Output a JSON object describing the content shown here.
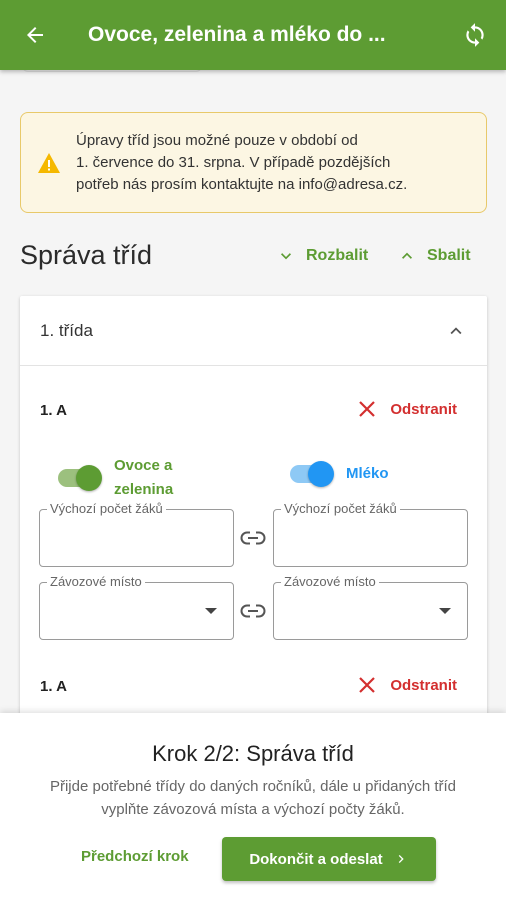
{
  "appbar": {
    "title": "Ovoce, zelenina a mléko do ...",
    "back_icon": "arrow-left-icon",
    "sync_icon": "sync-icon"
  },
  "alert": {
    "icon": "warning-icon",
    "text_line1": "Úpravy tříd jsou možné pouze v období od",
    "text_line2": "1. července do 31. srpna. V případě pozdějších",
    "text_line3": "potřeb nás prosím kontaktujte na info@adresa.cz."
  },
  "section": {
    "title": "Správa tříd",
    "expand_label": "Rozbalit",
    "collapse_label": "Sbalit"
  },
  "grade": {
    "label": "1. třída"
  },
  "classes": [
    {
      "name": "1. A",
      "remove_label": "Odstranit",
      "toggle_fruit_line1": "Ovoce a",
      "toggle_fruit_line2": "zelenina",
      "toggle_milk": "Mléko",
      "field_pupils_label": "Výchozí počet žáků",
      "field_place_label": "Závozové místo"
    },
    {
      "name": "1. A",
      "remove_label": "Odstranit"
    }
  ],
  "footer": {
    "step_title": "Krok 2/2: Správa tříd",
    "step_desc_line1": "Přijde potřebné třídy do daných ročníků, dále u přidaných tříd",
    "step_desc_line2": "vyplňte závozová místa a výchozí počty žáků.",
    "prev_label": "Předchozí krok",
    "next_label": "Dokončit a odeslat"
  },
  "colors": {
    "primary": "#5d9c33",
    "milk": "#2196f3",
    "danger": "#d32f2f",
    "warning": "#f5b800"
  }
}
